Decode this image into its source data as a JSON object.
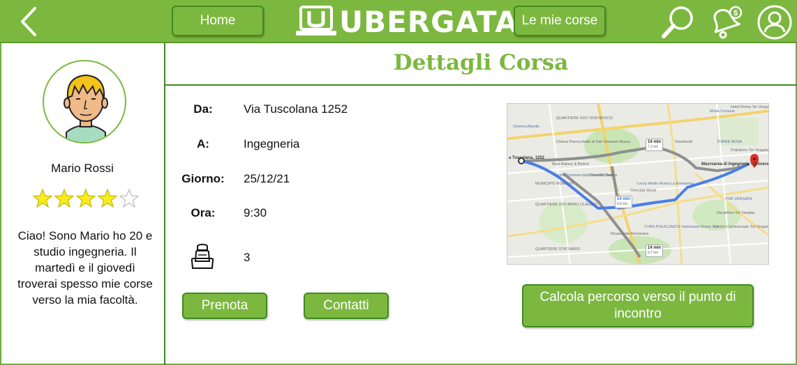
{
  "header": {
    "home_label": "Home",
    "logo_text": "UBERGATA",
    "my_rides_label": "Le mie corse",
    "icons": [
      "back-arrow-icon",
      "search-icon",
      "notification-bell-icon",
      "user-profile-icon"
    ],
    "background_color": "#7cb83f"
  },
  "sidebar": {
    "user_name": "Mario Rossi",
    "rating": 4,
    "rating_max": 5,
    "bio": "Ciao! Sono Mario ho 20 e studio ingegneria. Il martedì e il giovedì troverai spesso mie corse verso la mia facoltà."
  },
  "main": {
    "title": "Dettagli Corsa",
    "details": {
      "from_label": "Da:",
      "from_value": "Via Tuscolana 1252",
      "to_label": "A:",
      "to_value": "Ingegneria",
      "day_label": "Giorno:",
      "day_value": "25/12/21",
      "time_label": "Ora:",
      "time_value": "9:30",
      "seats_icon": "car-seat-icon",
      "seats_value": "3"
    },
    "buttons": {
      "book_label": "Prenota",
      "contacts_label": "Contatti",
      "route_label": "Calcola percorso verso il punto di incontro"
    },
    "map": {
      "origin_label": "a Tuscolana, 1252",
      "destination_label": "Macroarea di Ingegneria - Università di Roma...",
      "labels": [
        "Cinema Atlantic",
        "QUARTIERE XXIV DON BOSCO",
        "Chiesa Parrocchiale di San Giovanni Bosco",
        "Moda Comune",
        "Hotel Roma Tor Vergata",
        "Giardinetti",
        "TORRE NOVA",
        "Policlinico Tor Vergata",
        "Maxi Bakery & Bistrot",
        "Centro Commerciale Cinecittà Due",
        "Cinecittà Studios",
        "MUNICIPIO ROMA VII",
        "Leroy Merlin Roma La Romanina",
        "QUARTIERE XXV APPIO CLAUDIO",
        "Cinecittà World",
        "TOR VERGATA",
        "Decathlon Tor Vergata",
        "Centro Commerciale Tor Vergata",
        "CVRS POLICLINICO Veterinario Roma Sud",
        "QUARTIERE STATUARIO",
        "Rinascente Romanina"
      ],
      "durations": [
        "14 min",
        "14 min",
        "14 min"
      ],
      "distances": [
        "7,2 km",
        "6,6 km",
        "6,7 km"
      ],
      "route_color": "#4a7ee8"
    }
  }
}
